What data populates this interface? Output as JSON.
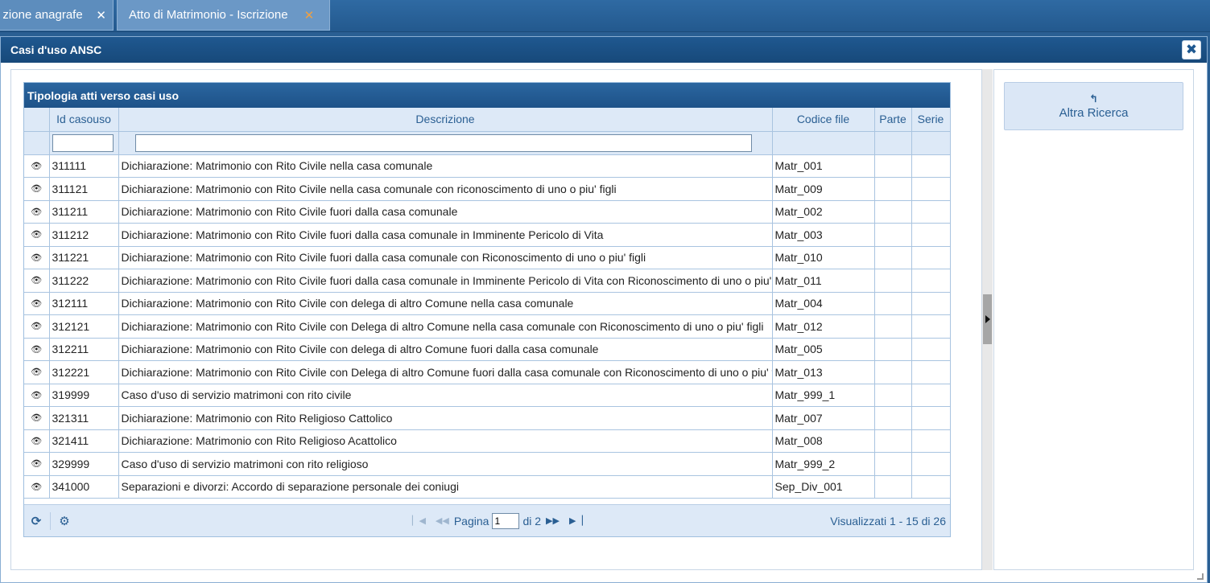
{
  "tabs": [
    {
      "label": "zione anagrafe",
      "close": "✕"
    },
    {
      "label": "Atto di Matrimonio - Iscrizione",
      "close": "✕"
    }
  ],
  "dialog": {
    "title": "Casi d'uso ANSC",
    "close": "✖"
  },
  "grid": {
    "caption": "Tipologia atti verso casi uso",
    "columns": [
      "",
      "Id casouso",
      "Descrizione",
      "Codice file",
      "Parte",
      "Serie"
    ],
    "filters": {
      "id": "",
      "descrizione": ""
    },
    "rows": [
      {
        "id": "311111",
        "desc": "Dichiarazione: Matrimonio con Rito Civile nella casa comunale",
        "file": "Matr_001"
      },
      {
        "id": "311121",
        "desc": "Dichiarazione: Matrimonio con Rito Civile nella casa comunale con riconoscimento di uno o piu' figli",
        "file": "Matr_009"
      },
      {
        "id": "311211",
        "desc": "Dichiarazione: Matrimonio con Rito Civile fuori dalla casa comunale",
        "file": "Matr_002"
      },
      {
        "id": "311212",
        "desc": "Dichiarazione: Matrimonio con Rito Civile fuori dalla casa comunale in Imminente Pericolo di Vita",
        "file": "Matr_003"
      },
      {
        "id": "311221",
        "desc": "Dichiarazione: Matrimonio con Rito Civile fuori dalla casa comunale con Riconoscimento di uno o piu' figli",
        "file": "Matr_010"
      },
      {
        "id": "311222",
        "desc": "Dichiarazione: Matrimonio con Rito Civile fuori dalla casa comunale in Imminente Pericolo di Vita con Riconoscimento di uno o piu' figli",
        "file": "Matr_011"
      },
      {
        "id": "312111",
        "desc": "Dichiarazione: Matrimonio con Rito Civile con delega di altro Comune nella casa comunale",
        "file": "Matr_004"
      },
      {
        "id": "312121",
        "desc": "Dichiarazione: Matrimonio con Rito Civile con Delega di altro Comune nella casa comunale con Riconoscimento di uno o piu' figli",
        "file": "Matr_012"
      },
      {
        "id": "312211",
        "desc": "Dichiarazione: Matrimonio con Rito Civile con delega di altro Comune fuori dalla casa comunale",
        "file": "Matr_005"
      },
      {
        "id": "312221",
        "desc": "Dichiarazione: Matrimonio con Rito Civile con Delega di altro Comune fuori dalla casa comunale con Riconoscimento di uno o piu' figli",
        "file": "Matr_013"
      },
      {
        "id": "319999",
        "desc": "Caso d'uso di servizio matrimoni con rito civile",
        "file": "Matr_999_1"
      },
      {
        "id": "321311",
        "desc": "Dichiarazione: Matrimonio con Rito Religioso Cattolico",
        "file": "Matr_007"
      },
      {
        "id": "321411",
        "desc": "Dichiarazione: Matrimonio con Rito Religioso Acattolico",
        "file": "Matr_008"
      },
      {
        "id": "329999",
        "desc": "Caso d'uso di servizio matrimoni con rito religioso",
        "file": "Matr_999_2"
      },
      {
        "id": "341000",
        "desc": "Separazioni e divorzi: Accordo di separazione personale dei coniugi",
        "file": "Sep_Div_001"
      }
    ],
    "row_icon": "eye-icon",
    "pager": {
      "page_label": "Pagina",
      "page": "1",
      "of_label": "di 2",
      "summary": "Visualizzati 1 - 15 di 26"
    }
  },
  "side": {
    "altra_ricerca": "Altra Ricerca",
    "back_icon": "↰"
  },
  "colors": {
    "accent": "#2a5f93",
    "header_bg": "#dde9f7",
    "tab_close_active": "#f0a040"
  }
}
